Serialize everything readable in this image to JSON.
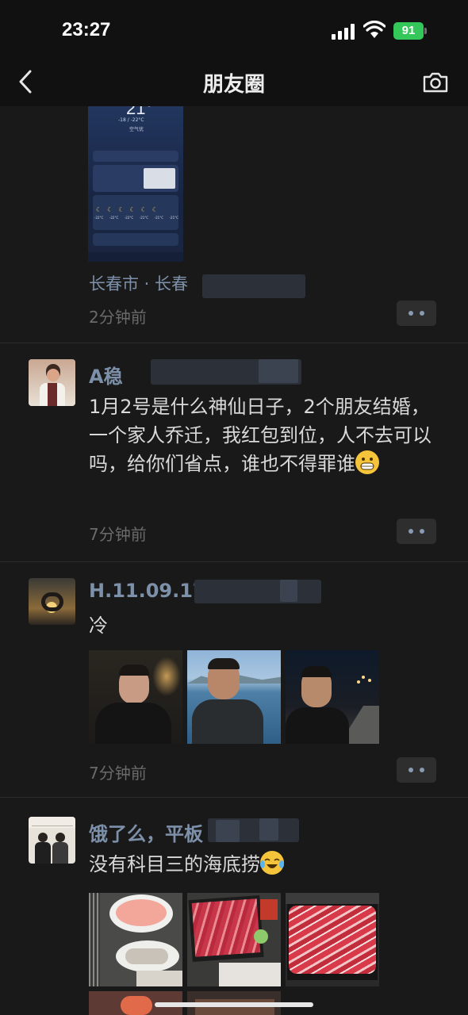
{
  "status": {
    "time": "23:27",
    "battery": "91"
  },
  "nav": {
    "title": "朋友圈"
  },
  "posts": [
    {
      "location": "长春市 · 长春",
      "time": "2分钟前",
      "screenshot": {
        "temp": "21°",
        "range": "-18 / -22°C",
        "aqi": "空气优",
        "forecast": [
          "-22°C",
          "-22°C",
          "-22°C",
          "-21°C",
          "-21°C",
          "-21°C"
        ]
      }
    },
    {
      "name": "A稳",
      "text": "1月2号是什么神仙日子，2个朋友结婚，一个家人乔迁，我红包到位，人不去可以吗，给你们省点，谁也不得罪谁",
      "time": "7分钟前"
    },
    {
      "name": "H.11.09.17",
      "text": "冷",
      "time": "7分钟前"
    },
    {
      "name": "饿了么，平板",
      "text": "没有科目三的海底捞"
    }
  ],
  "colors": {
    "link": "#7d90a9",
    "background": "#191919",
    "battery": "#34c759"
  },
  "icons": [
    "back-icon",
    "camera-icon",
    "more-dots-icon",
    "signal-icon",
    "wifi-icon",
    "battery-icon"
  ]
}
